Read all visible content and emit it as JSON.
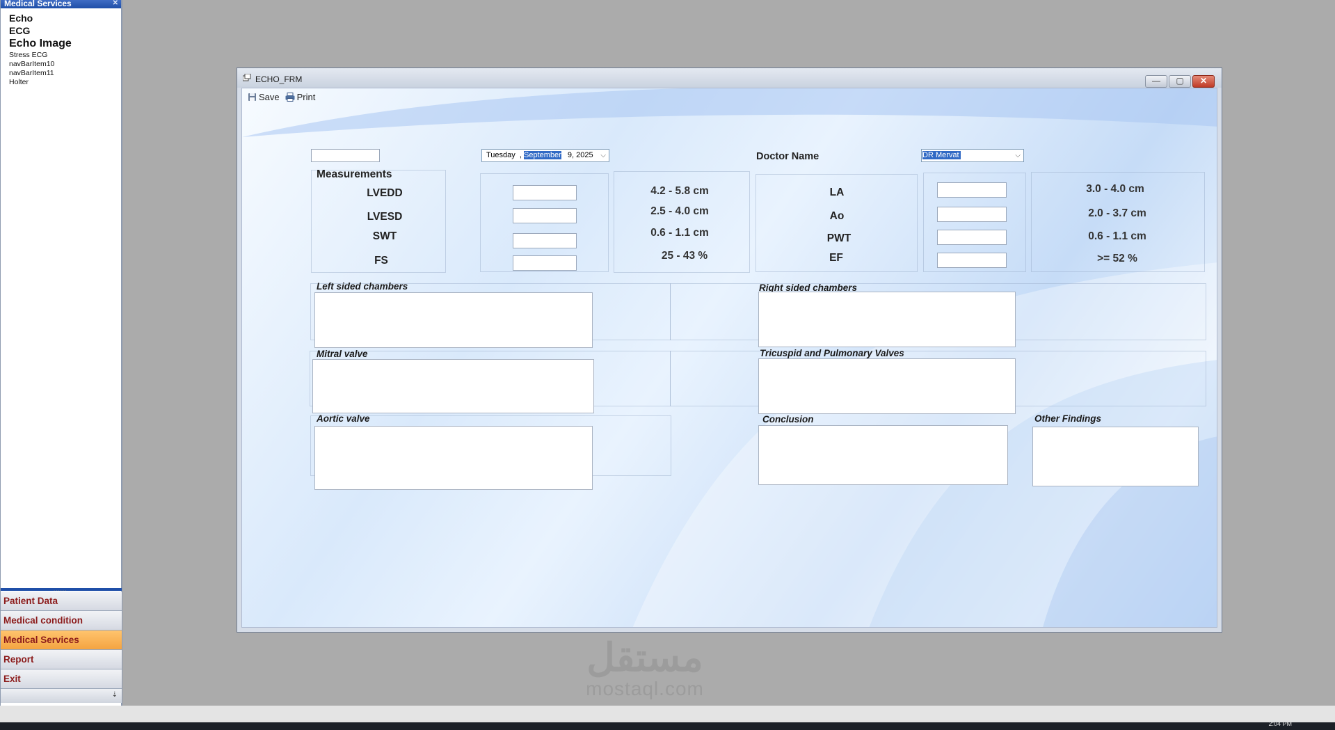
{
  "nav": {
    "header": "Medical Services",
    "items": [
      "Echo",
      "ECG",
      "Echo Image",
      "Stress ECG",
      "navBarItem10",
      "navBarItem11",
      "Holter"
    ],
    "groups": [
      "Patient Data",
      "Medical condition",
      "Medical Services",
      "Report",
      "Exit"
    ],
    "active_group": "Medical Services"
  },
  "window": {
    "title": "ECHO_FRM",
    "toolbar": {
      "save_label": "Save",
      "print_label": "Print"
    },
    "date_picker": {
      "weekday": "Tuesday",
      "month": "September",
      "day_year": "9, 2025"
    },
    "doctor": {
      "label": "Doctor Name",
      "value": "DR Mervat"
    },
    "measurements": {
      "title": "Measurements",
      "left": [
        {
          "label": "LVEDD",
          "range": "4.2 - 5.8 cm"
        },
        {
          "label": "LVESD",
          "range": "2.5 - 4.0 cm"
        },
        {
          "label": "SWT",
          "range": "0.6 - 1.1 cm"
        },
        {
          "label": "FS",
          "range": "25 - 43 %"
        }
      ],
      "right": [
        {
          "label": "LA",
          "range": "3.0 - 4.0 cm"
        },
        {
          "label": "Ao",
          "range": "2.0 - 3.7 cm"
        },
        {
          "label": "PWT",
          "range": "0.6 - 1.1 cm"
        },
        {
          "label": "EF",
          "range": ">= 52 %"
        }
      ]
    },
    "sections": {
      "left_chambers": "Left sided chambers",
      "right_chambers": "Right sided chambers",
      "mitral": "Mitral valve",
      "tricuspid": "Tricuspid and Pulmonary Valves",
      "aortic": "Aortic valve",
      "conclusion": "Conclusion",
      "other": "Other Findings"
    }
  },
  "watermark": {
    "arabic": "مستقل",
    "latin": "mostaql.com"
  },
  "taskbar": {
    "clock": "2:04 PM"
  },
  "colors": {
    "nav_header": "#1f4fa8",
    "active_group": "#f4a441",
    "group_text": "#8b1a1a",
    "close_button": "#bf3b26"
  }
}
